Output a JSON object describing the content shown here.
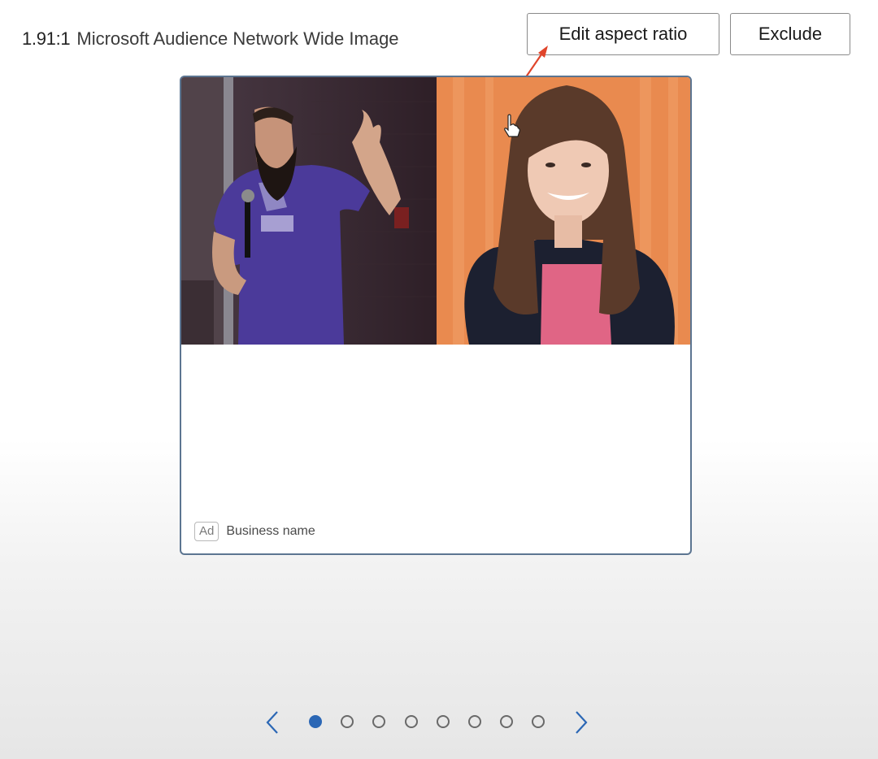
{
  "header": {
    "aspect_ratio": "1.91:1",
    "placement_name": "Microsoft Audience Network Wide Image",
    "edit_button": "Edit aspect ratio",
    "exclude_button": "Exclude"
  },
  "ad_preview": {
    "ad_badge": "Ad",
    "business_name": "Business name"
  },
  "pagination": {
    "total_pages": 8,
    "current_page": 1,
    "accent_color": "#2b67b5"
  },
  "colors": {
    "annotation_arrow": "#e0452b",
    "card_border": "#5c7591"
  }
}
